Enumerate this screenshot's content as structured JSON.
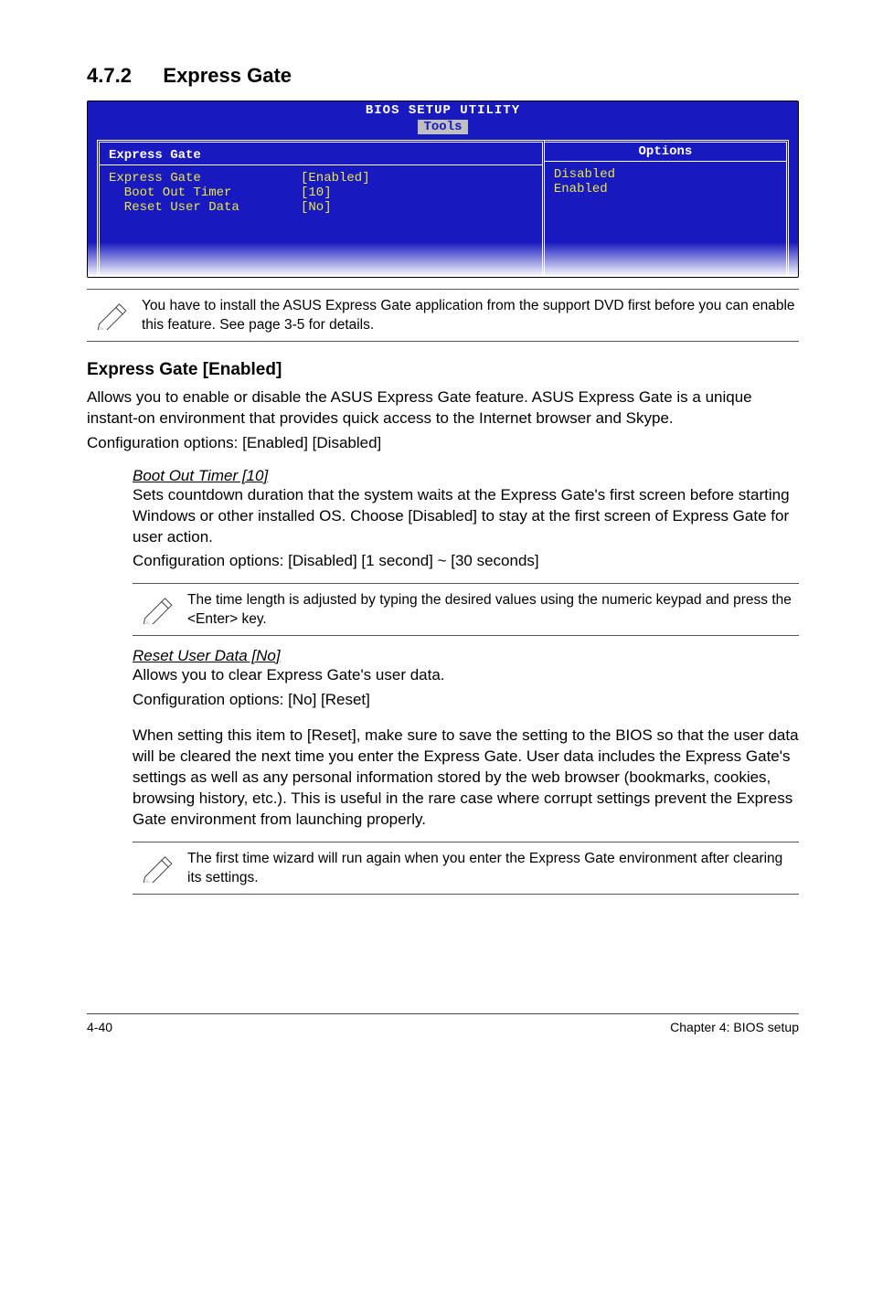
{
  "section": {
    "num": "4.7.2",
    "title": "Express Gate"
  },
  "bios": {
    "title": "BIOS SETUP UTILITY",
    "tab": "Tools",
    "leftHeader": "Express Gate",
    "rows": [
      {
        "k": "Express Gate",
        "v": "[Enabled]"
      },
      {
        "k": "  Boot Out Timer",
        "v": "[10]"
      },
      {
        "k": "  Reset User Data",
        "v": "[No]"
      }
    ],
    "rightHeader": "Options",
    "options": [
      "Disabled",
      "Enabled"
    ]
  },
  "note1": "You have to install the ASUS Express Gate application from the support DVD first before you can enable this feature. See page 3-5 for details.",
  "h2a": "Express Gate [Enabled]",
  "p1": "Allows you to enable or disable the ASUS Express Gate feature. ASUS Express Gate is a unique instant-on environment that provides quick access to the Internet browser and Skype.",
  "p1b": "Configuration options: [Enabled] [Disabled]",
  "bootHdr": "Boot Out Timer [10]",
  "bootP": "Sets countdown duration that the system waits at the Express Gate's first screen before starting Windows or other installed OS. Choose [Disabled] to stay at the first screen of Express Gate for user action.",
  "bootP2": "Configuration options: [Disabled] [1 second] ~ [30 seconds]",
  "note2": "The time length is adjusted by typing the desired values using the numeric keypad and press the <Enter> key.",
  "resetHdr": "Reset User Data [No]",
  "resetP1": "Allows you to clear Express Gate's user data.",
  "resetP2": "Configuration options: [No] [Reset]",
  "resetP3": "When setting this item to [Reset], make sure to save the setting to the BIOS so that the user data will be cleared the next time you enter the Express Gate. User data includes the Express Gate's settings as well as any personal information stored by the web browser (bookmarks, cookies, browsing history, etc.). This is useful in the rare case where corrupt settings prevent the Express Gate environment from launching properly.",
  "note3": "The first time wizard will run again when you enter the Express Gate environment after clearing its settings.",
  "footer": {
    "left": "4-40",
    "right": "Chapter 4: BIOS setup"
  }
}
